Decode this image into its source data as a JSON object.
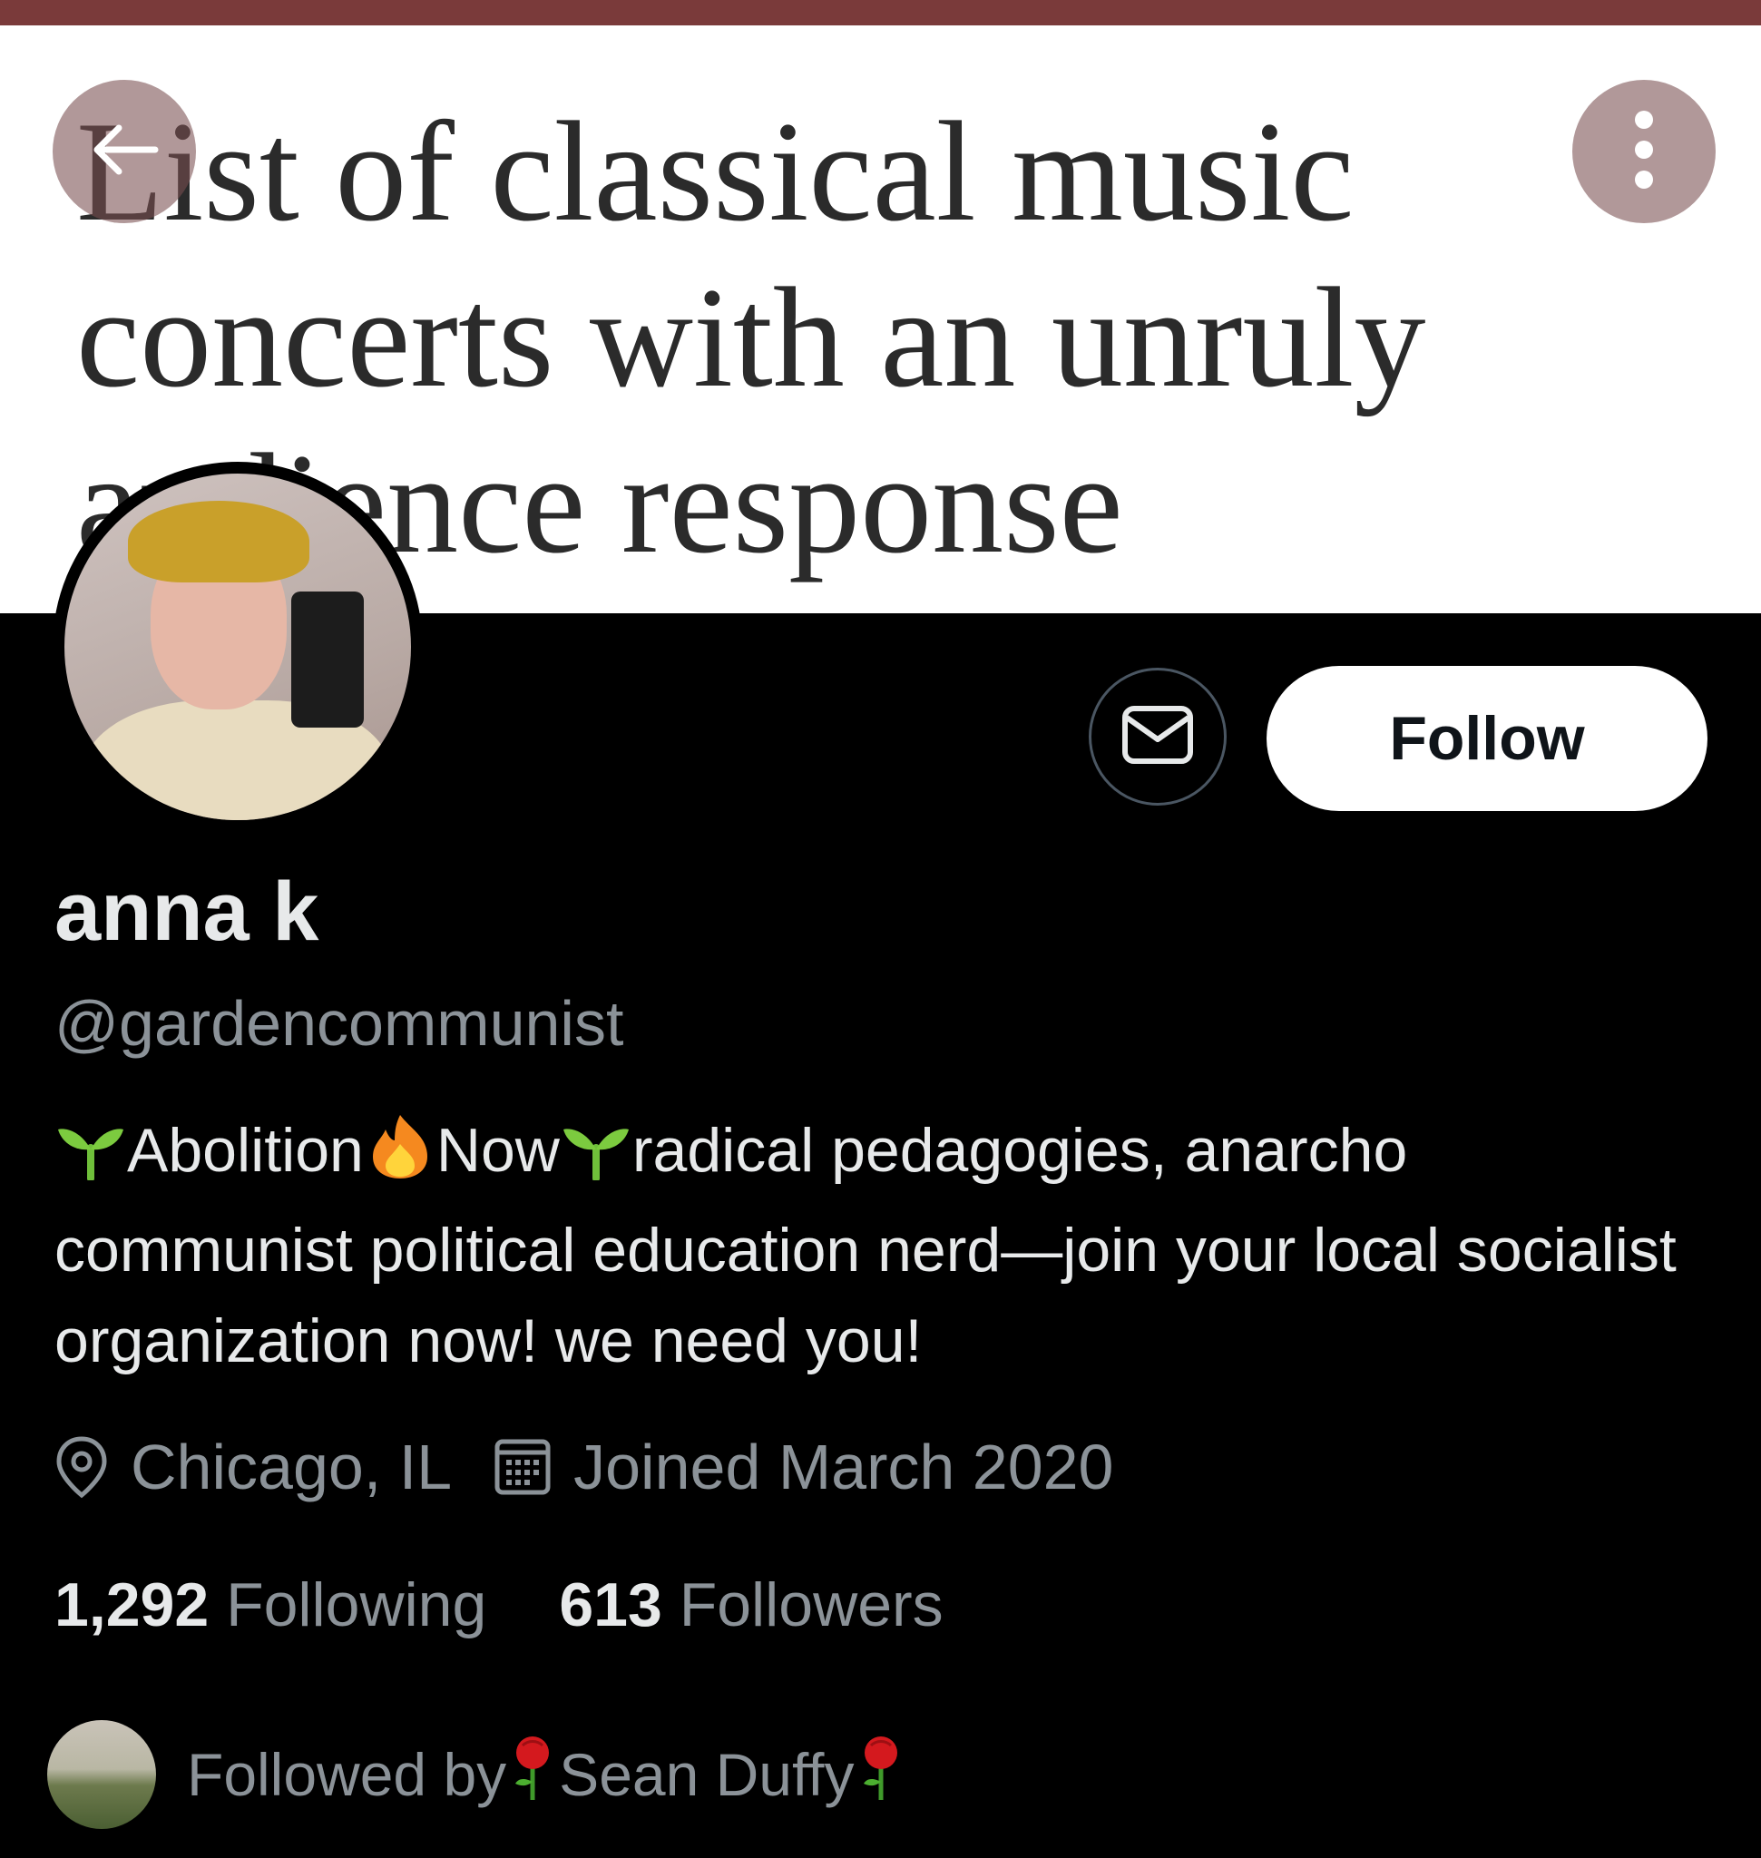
{
  "banner": {
    "headline": "List of classical music concerts with an unruly audience response",
    "back_icon": "arrow-left-icon",
    "more_icon": "more-vertical-icon"
  },
  "profile": {
    "name": "anna k",
    "handle": "@gardencommunist",
    "bio": {
      "part1": "Abolition",
      "part2": "Now",
      "part3": "radical pedagogies, anarcho communist political education nerd—join your local socialist organization now! we need you!",
      "emoji_1": "seedling",
      "emoji_2": "fire",
      "emoji_3": "seedling"
    },
    "location": "Chicago, IL",
    "joined": "Joined March 2020",
    "following_count": "1,292",
    "following_label": "Following",
    "followers_count": "613",
    "followers_label": "Followers",
    "followed_by_label": "Followed by",
    "followed_by_name": "Sean Duffy",
    "followed_by_emoji": "rose"
  },
  "actions": {
    "follow_label": "Follow",
    "message_icon": "envelope-icon"
  },
  "colors": {
    "top_bar": "#7a3a3a",
    "background": "#000000",
    "primary_text": "#e7e9ea",
    "secondary_text": "#8b9298",
    "overlay_button": "#9c7577"
  }
}
